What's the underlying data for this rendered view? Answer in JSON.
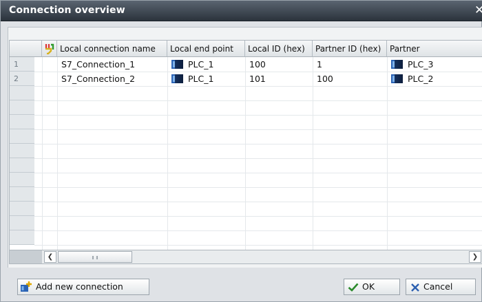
{
  "window": {
    "title": "Connection overview"
  },
  "table": {
    "headers": [
      "Local connection name",
      "Local end point",
      "Local ID (hex)",
      "Partner ID (hex)",
      "Partner"
    ],
    "rows": [
      {
        "num": "1",
        "name": "S7_Connection_1",
        "local_end_point": "PLC_1",
        "local_id": "100",
        "partner_id": "1",
        "partner": "PLC_3"
      },
      {
        "num": "2",
        "name": "S7_Connection_2",
        "local_end_point": "PLC_1",
        "local_id": "101",
        "partner_id": "100",
        "partner": "PLC_2"
      }
    ]
  },
  "buttons": {
    "add_new": "Add new connection",
    "ok": "OK",
    "cancel": "Cancel"
  },
  "icons": {
    "connection_icon": "network-connection-icon",
    "device_icon": "plc-device-icon"
  },
  "colors": {
    "titlebar": "#2b333c",
    "device_blue": "#2b63b5",
    "ok_check": "#2a8a2a",
    "cancel_x": "#2b5fb0"
  }
}
